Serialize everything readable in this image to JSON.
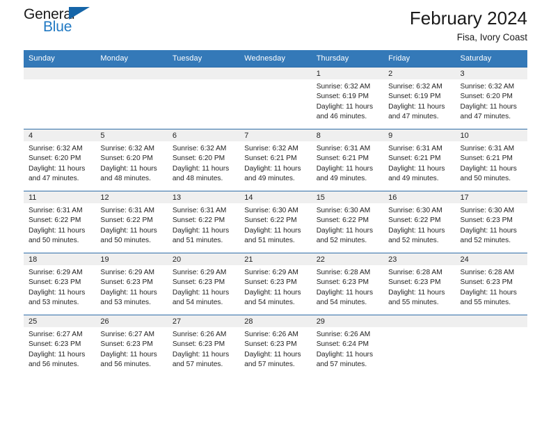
{
  "brand": {
    "name_part1": "General",
    "name_part2": "Blue",
    "accent_color": "#2079c3",
    "triangle_color": "#1565a8"
  },
  "header": {
    "title": "February 2024",
    "location": "Fisa, Ivory Coast"
  },
  "calendar": {
    "header_bg": "#3479b8",
    "border_color": "#2e6da8",
    "daynum_bg": "#efefef",
    "weekday_headers": [
      "Sunday",
      "Monday",
      "Tuesday",
      "Wednesday",
      "Thursday",
      "Friday",
      "Saturday"
    ],
    "weeks": [
      [
        {
          "day": "",
          "empty": true
        },
        {
          "day": "",
          "empty": true
        },
        {
          "day": "",
          "empty": true
        },
        {
          "day": "",
          "empty": true
        },
        {
          "day": "1",
          "sunrise": "Sunrise: 6:32 AM",
          "sunset": "Sunset: 6:19 PM",
          "daylight_line1": "Daylight: 11 hours",
          "daylight_line2": "and 46 minutes."
        },
        {
          "day": "2",
          "sunrise": "Sunrise: 6:32 AM",
          "sunset": "Sunset: 6:19 PM",
          "daylight_line1": "Daylight: 11 hours",
          "daylight_line2": "and 47 minutes."
        },
        {
          "day": "3",
          "sunrise": "Sunrise: 6:32 AM",
          "sunset": "Sunset: 6:20 PM",
          "daylight_line1": "Daylight: 11 hours",
          "daylight_line2": "and 47 minutes."
        }
      ],
      [
        {
          "day": "4",
          "sunrise": "Sunrise: 6:32 AM",
          "sunset": "Sunset: 6:20 PM",
          "daylight_line1": "Daylight: 11 hours",
          "daylight_line2": "and 47 minutes."
        },
        {
          "day": "5",
          "sunrise": "Sunrise: 6:32 AM",
          "sunset": "Sunset: 6:20 PM",
          "daylight_line1": "Daylight: 11 hours",
          "daylight_line2": "and 48 minutes."
        },
        {
          "day": "6",
          "sunrise": "Sunrise: 6:32 AM",
          "sunset": "Sunset: 6:20 PM",
          "daylight_line1": "Daylight: 11 hours",
          "daylight_line2": "and 48 minutes."
        },
        {
          "day": "7",
          "sunrise": "Sunrise: 6:32 AM",
          "sunset": "Sunset: 6:21 PM",
          "daylight_line1": "Daylight: 11 hours",
          "daylight_line2": "and 49 minutes."
        },
        {
          "day": "8",
          "sunrise": "Sunrise: 6:31 AM",
          "sunset": "Sunset: 6:21 PM",
          "daylight_line1": "Daylight: 11 hours",
          "daylight_line2": "and 49 minutes."
        },
        {
          "day": "9",
          "sunrise": "Sunrise: 6:31 AM",
          "sunset": "Sunset: 6:21 PM",
          "daylight_line1": "Daylight: 11 hours",
          "daylight_line2": "and 49 minutes."
        },
        {
          "day": "10",
          "sunrise": "Sunrise: 6:31 AM",
          "sunset": "Sunset: 6:21 PM",
          "daylight_line1": "Daylight: 11 hours",
          "daylight_line2": "and 50 minutes."
        }
      ],
      [
        {
          "day": "11",
          "sunrise": "Sunrise: 6:31 AM",
          "sunset": "Sunset: 6:22 PM",
          "daylight_line1": "Daylight: 11 hours",
          "daylight_line2": "and 50 minutes."
        },
        {
          "day": "12",
          "sunrise": "Sunrise: 6:31 AM",
          "sunset": "Sunset: 6:22 PM",
          "daylight_line1": "Daylight: 11 hours",
          "daylight_line2": "and 50 minutes."
        },
        {
          "day": "13",
          "sunrise": "Sunrise: 6:31 AM",
          "sunset": "Sunset: 6:22 PM",
          "daylight_line1": "Daylight: 11 hours",
          "daylight_line2": "and 51 minutes."
        },
        {
          "day": "14",
          "sunrise": "Sunrise: 6:30 AM",
          "sunset": "Sunset: 6:22 PM",
          "daylight_line1": "Daylight: 11 hours",
          "daylight_line2": "and 51 minutes."
        },
        {
          "day": "15",
          "sunrise": "Sunrise: 6:30 AM",
          "sunset": "Sunset: 6:22 PM",
          "daylight_line1": "Daylight: 11 hours",
          "daylight_line2": "and 52 minutes."
        },
        {
          "day": "16",
          "sunrise": "Sunrise: 6:30 AM",
          "sunset": "Sunset: 6:22 PM",
          "daylight_line1": "Daylight: 11 hours",
          "daylight_line2": "and 52 minutes."
        },
        {
          "day": "17",
          "sunrise": "Sunrise: 6:30 AM",
          "sunset": "Sunset: 6:23 PM",
          "daylight_line1": "Daylight: 11 hours",
          "daylight_line2": "and 52 minutes."
        }
      ],
      [
        {
          "day": "18",
          "sunrise": "Sunrise: 6:29 AM",
          "sunset": "Sunset: 6:23 PM",
          "daylight_line1": "Daylight: 11 hours",
          "daylight_line2": "and 53 minutes."
        },
        {
          "day": "19",
          "sunrise": "Sunrise: 6:29 AM",
          "sunset": "Sunset: 6:23 PM",
          "daylight_line1": "Daylight: 11 hours",
          "daylight_line2": "and 53 minutes."
        },
        {
          "day": "20",
          "sunrise": "Sunrise: 6:29 AM",
          "sunset": "Sunset: 6:23 PM",
          "daylight_line1": "Daylight: 11 hours",
          "daylight_line2": "and 54 minutes."
        },
        {
          "day": "21",
          "sunrise": "Sunrise: 6:29 AM",
          "sunset": "Sunset: 6:23 PM",
          "daylight_line1": "Daylight: 11 hours",
          "daylight_line2": "and 54 minutes."
        },
        {
          "day": "22",
          "sunrise": "Sunrise: 6:28 AM",
          "sunset": "Sunset: 6:23 PM",
          "daylight_line1": "Daylight: 11 hours",
          "daylight_line2": "and 54 minutes."
        },
        {
          "day": "23",
          "sunrise": "Sunrise: 6:28 AM",
          "sunset": "Sunset: 6:23 PM",
          "daylight_line1": "Daylight: 11 hours",
          "daylight_line2": "and 55 minutes."
        },
        {
          "day": "24",
          "sunrise": "Sunrise: 6:28 AM",
          "sunset": "Sunset: 6:23 PM",
          "daylight_line1": "Daylight: 11 hours",
          "daylight_line2": "and 55 minutes."
        }
      ],
      [
        {
          "day": "25",
          "sunrise": "Sunrise: 6:27 AM",
          "sunset": "Sunset: 6:23 PM",
          "daylight_line1": "Daylight: 11 hours",
          "daylight_line2": "and 56 minutes."
        },
        {
          "day": "26",
          "sunrise": "Sunrise: 6:27 AM",
          "sunset": "Sunset: 6:23 PM",
          "daylight_line1": "Daylight: 11 hours",
          "daylight_line2": "and 56 minutes."
        },
        {
          "day": "27",
          "sunrise": "Sunrise: 6:26 AM",
          "sunset": "Sunset: 6:23 PM",
          "daylight_line1": "Daylight: 11 hours",
          "daylight_line2": "and 57 minutes."
        },
        {
          "day": "28",
          "sunrise": "Sunrise: 6:26 AM",
          "sunset": "Sunset: 6:23 PM",
          "daylight_line1": "Daylight: 11 hours",
          "daylight_line2": "and 57 minutes."
        },
        {
          "day": "29",
          "sunrise": "Sunrise: 6:26 AM",
          "sunset": "Sunset: 6:24 PM",
          "daylight_line1": "Daylight: 11 hours",
          "daylight_line2": "and 57 minutes."
        },
        {
          "day": "",
          "empty": true
        },
        {
          "day": "",
          "empty": true
        }
      ]
    ]
  }
}
